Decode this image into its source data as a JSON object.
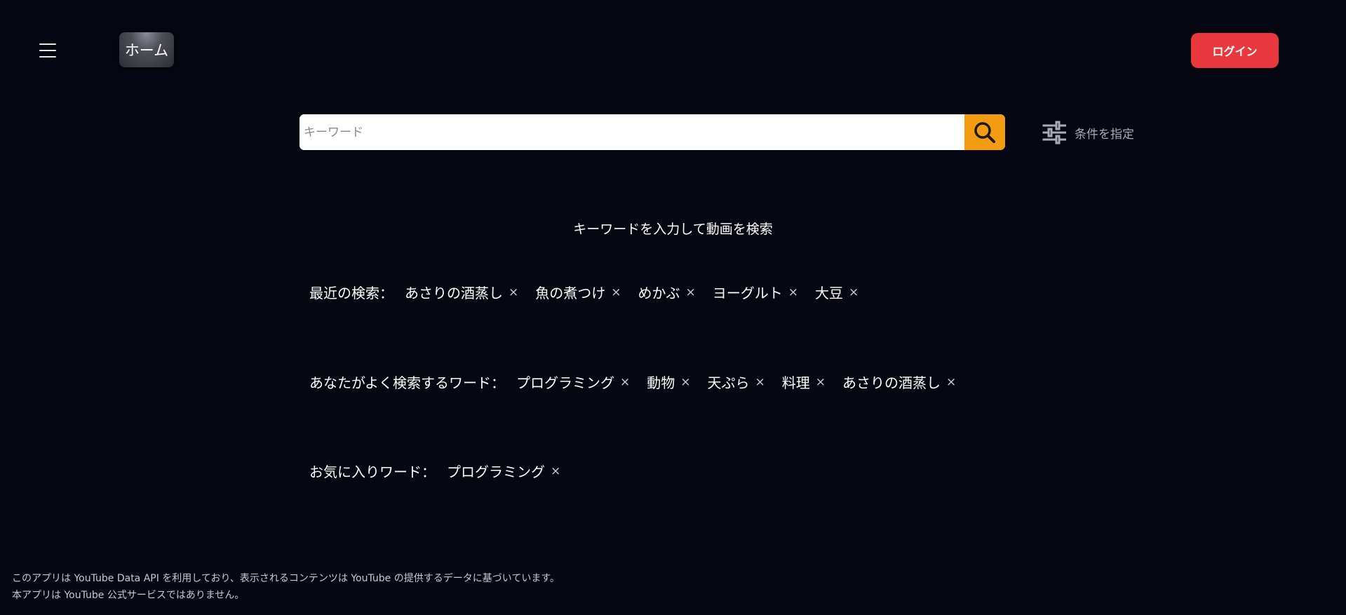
{
  "header": {
    "menu_icon": "hamburger-icon",
    "home_label": "ホーム",
    "login_label": "ログイン"
  },
  "search": {
    "placeholder": "キーワード",
    "value": "",
    "search_icon": "search-icon",
    "filter_icon": "sliders-icon",
    "filter_label": "条件を指定"
  },
  "hint": "キーワードを入力して動画を検索",
  "recent": {
    "label": "最近の検索：",
    "items": [
      "あさりの酒蒸し",
      "魚の煮つけ",
      "めかぶ",
      "ヨーグルト",
      "大豆"
    ]
  },
  "frequent": {
    "label": "あなたがよく検索するワード：",
    "items": [
      "プログラミング",
      "動物",
      "天ぷら",
      "料理",
      "あさりの酒蒸し"
    ]
  },
  "favorites": {
    "label": "お気に入りワード：",
    "items": [
      "プログラミング"
    ]
  },
  "remove_glyph": "×",
  "footer": {
    "line1": "このアプリは YouTube Data API を利用しており、表示されるコンテンツは YouTube の提供するデータに基づいています。",
    "line2": "本アプリは YouTube 公式サービスではありません。"
  },
  "colors": {
    "background": "#050812",
    "login": "#e8383e",
    "search_button": "#f39c12"
  }
}
